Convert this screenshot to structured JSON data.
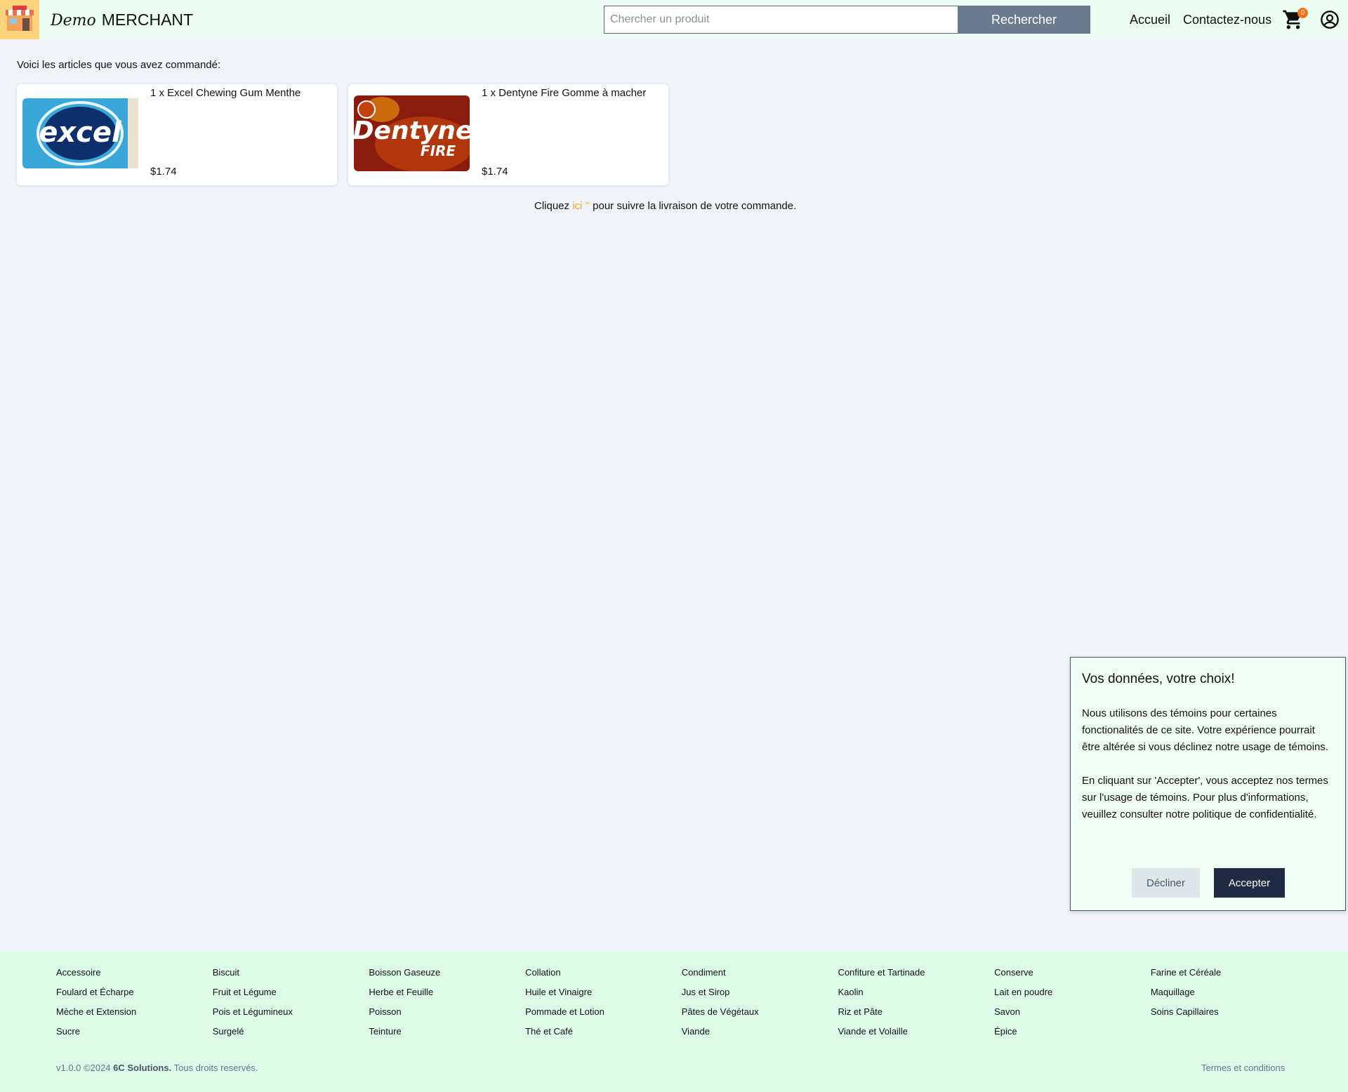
{
  "header": {
    "brand_prefix": "Demo",
    "brand_name": "MERCHANT",
    "search_placeholder": "Chercher un produit",
    "search_button": "Rechercher",
    "nav_home": "Accueil",
    "nav_contact": "Contactez-nous",
    "cart_count": "0",
    "cart_icon": "cart-icon",
    "account_icon": "account-icon"
  },
  "order": {
    "intro": "Voici les articles que vous avez commandé:",
    "items": [
      {
        "title": "1 x Excel Chewing Gum Menthe",
        "price": "$1.74",
        "image": "excel-gum-image"
      },
      {
        "title": "1 x Dentyne Fire Gomme à macher",
        "price": "$1.74",
        "image": "dentyne-fire-image"
      }
    ],
    "track_prefix": "Cliquez",
    "track_link": "ici",
    "track_suffix": "pour suivre la livraison de votre commande."
  },
  "cookie": {
    "title": "Vos données, votre choix!",
    "paragraph1": "Nous utilisons des témoins pour certaines fonctionalités de ce site. Votre expérience pourrait être altérée si vous déclinez notre usage de témoins.",
    "paragraph2": "En cliquant sur 'Accepter', vous acceptez nos termes sur l'usage de témoins. Pour plus d'informations, veuillez consulter notre politique de confidentialité.",
    "decline": "Décliner",
    "accept": "Accepter"
  },
  "footer": {
    "categories": [
      "Accessoire",
      "Biscuit",
      "Boisson Gaseuze",
      "Collation",
      "Condiment",
      "Confiture et Tartinade",
      "Conserve",
      "Farine et Céréale",
      "Foulard et Écharpe",
      "Fruit et Légume",
      "Herbe et Feuille",
      "Huile et Vinaigre",
      "Jus et Sirop",
      "Kaolin",
      "Lait en poudre",
      "Maquillage",
      "Mèche et Extension",
      "Pois et Légumineux",
      "Poisson",
      "Pommade et Lotion",
      "Pâtes de Végétaux",
      "Riz et Pâte",
      "Savon",
      "Soins Capillaires",
      "Sucre",
      "Surgelé",
      "Teinture",
      "Thé et Café",
      "Viande",
      "Viande et Volaille",
      "Épice"
    ],
    "version": "v1.0.0 ©2024",
    "company": "6C Solutions.",
    "rights": "Tous droits reservés.",
    "terms": "Termes et conditions"
  },
  "colors": {
    "header_bg": "#ecfdf3",
    "page_bg": "#f0f4f8",
    "search_button": "#6b7a8f",
    "link_accent": "#f5a524",
    "badge": "#f97316",
    "accept_button": "#1f2a44",
    "footer_bg": "#dcfce7"
  }
}
